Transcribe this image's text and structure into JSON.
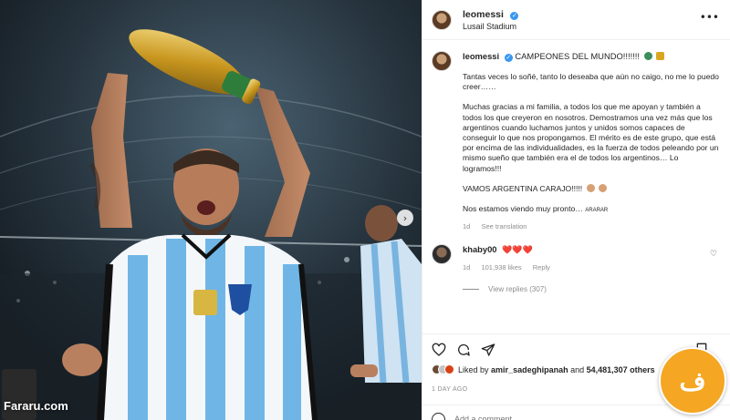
{
  "photo": {
    "watermark": "Fararu.com",
    "next_arrow": "›"
  },
  "post": {
    "username": "leomessi",
    "location": "Lusail Stadium",
    "more_icon": "more-horizontal-icon"
  },
  "caption": {
    "username": "leomessi",
    "title": "CAMPEONES DEL MUNDO!!!!!!!",
    "p1": "Tantas veces lo soñé, tanto lo deseaba que aún no caigo, no me lo puedo creer……",
    "p2": "Muchas gracias a mi familia, a todos los que me apoyan y también a todos los que creyeron en nosotros. Demostramos una vez más que los argentinos cuando luchamos juntos y unidos somos capaces de conseguir lo que nos propongamos. El mérito es de este grupo, que está por encima de las individualidades, es la fuerza de todos peleando por un mismo sueño que también era el de todos los argentinos… Lo logramos!!!",
    "p3": "VAMOS ARGENTINA CARAJO!!!!!",
    "p4": "Nos estamos viendo muy pronto…",
    "p4_tag": "ARARAR",
    "time": "1d",
    "see_translation": "See translation"
  },
  "comment": {
    "username": "khaby00",
    "hearts": "❤️❤️❤️",
    "time": "1d",
    "likes": "101,938 likes",
    "reply": "Reply",
    "view_replies": "View replies (307)"
  },
  "likes_line": {
    "prefix": "Liked by",
    "user": "amir_sadeghipanah",
    "and": "and",
    "others": "54,481,307 others"
  },
  "time_ago": "1 DAY AGO",
  "add_comment": {
    "placeholder": "Add a comment..."
  },
  "colors": {
    "verified": "#3897f0",
    "heart": "#e0245e",
    "muted": "#8e8e8e",
    "badge": "#f5a623"
  },
  "icons": [
    "heart-icon",
    "comment-icon",
    "share-icon",
    "bookmark-icon",
    "emoji-icon",
    "verified-icon"
  ]
}
